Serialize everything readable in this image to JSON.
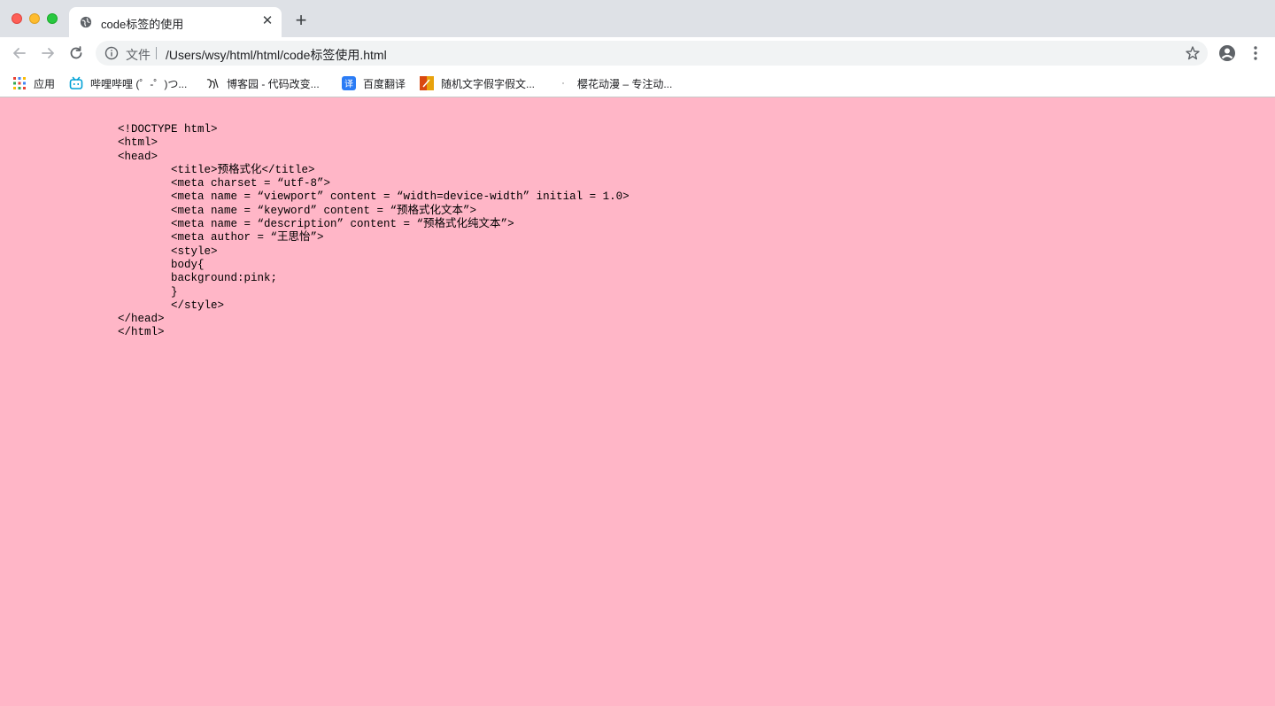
{
  "browser": {
    "tab": {
      "title": "code标签的使用",
      "close_label": "✕",
      "favicon": "globe-icon"
    },
    "new_tab_label": "+",
    "omnibox": {
      "label": "文件",
      "url": "/Users/wsy/html/html/code标签使用.html"
    },
    "bookmarks": [
      {
        "label": "应用",
        "icon": "apps-grid-icon"
      },
      {
        "label": "哔哩哔哩 (゜-゜)つ...",
        "icon": "bilibili-icon"
      },
      {
        "label": "博客园 - 代码改变...",
        "icon": "cnblogs-icon"
      },
      {
        "label": "百度翻译",
        "icon": "baidu-translate-icon"
      },
      {
        "label": "随机文字假字假文...",
        "icon": "random-text-icon"
      },
      {
        "label": "樱花动漫 – 专注动...",
        "icon": "blank-favicon-icon"
      }
    ]
  },
  "page": {
    "background_color": "#ffb6c7",
    "code_text": "<!DOCTYPE html>\n<html>\n<head>\n\t<title>预格式化</title>\n\t<meta charset = “utf-8”>\n\t<meta name = “viewport” content = “width=device-width” initial = 1.0>\n\t<meta name = “keyword” content = “预格式化文本”>\n\t<meta name = “description” content = “预格式化纯文本”>\n\t<meta author = “王思怡”>\n\t<style>\n\tbody{\n\tbackground:pink;\n\t}\n\t</style>\n</head>\n</html>"
  }
}
